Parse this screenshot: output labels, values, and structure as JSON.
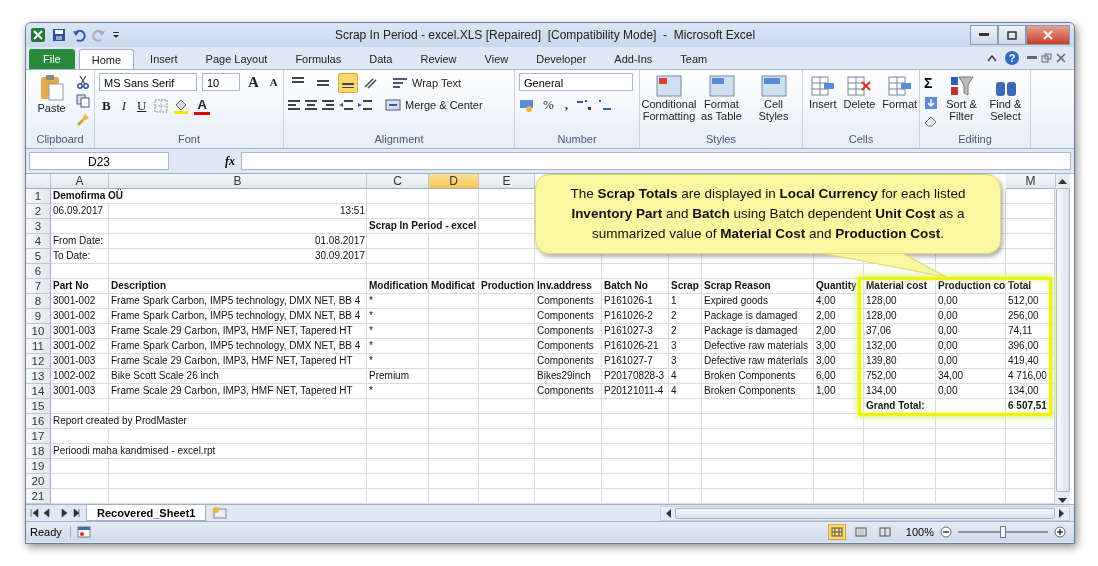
{
  "window": {
    "title": "Scrap In Period - excel.XLS [Repaired]  [Compatibility Mode]  -  Microsoft Excel"
  },
  "ribbon_tabs": [
    {
      "label": "File",
      "kind": "file",
      "selected": false
    },
    {
      "label": "Home",
      "kind": "tab",
      "selected": true
    },
    {
      "label": "Insert",
      "kind": "tab",
      "selected": false
    },
    {
      "label": "Page Layout",
      "kind": "tab",
      "selected": false
    },
    {
      "label": "Formulas",
      "kind": "tab",
      "selected": false
    },
    {
      "label": "Data",
      "kind": "tab",
      "selected": false
    },
    {
      "label": "Review",
      "kind": "tab",
      "selected": false
    },
    {
      "label": "View",
      "kind": "tab",
      "selected": false
    },
    {
      "label": "Developer",
      "kind": "tab",
      "selected": false
    },
    {
      "label": "Add-Ins",
      "kind": "tab",
      "selected": false
    },
    {
      "label": "Team",
      "kind": "tab",
      "selected": false
    }
  ],
  "help": "?",
  "clipboard": {
    "label": "Clipboard",
    "paste": "Paste"
  },
  "font": {
    "label": "Font",
    "name": "MS Sans Serif",
    "size": "10",
    "grow": "A",
    "shrink": "A",
    "bold": "B",
    "italic": "I",
    "underline": "U",
    "color_letter": "A"
  },
  "alignment": {
    "label": "Alignment",
    "vertical": [
      {
        "selected": false
      },
      {
        "selected": false
      },
      {
        "selected": true
      }
    ],
    "wrap": "Wrap Text",
    "merge": "Merge & Center"
  },
  "number": {
    "label": "Number",
    "format": "General",
    "percent": "%",
    "comma": ","
  },
  "styles": {
    "label": "Styles",
    "buttons": [
      "Conditional Formatting",
      "Format as Table",
      "Cell Styles"
    ]
  },
  "cells": {
    "label": "Cells",
    "buttons": [
      "Insert",
      "Delete",
      "Format"
    ]
  },
  "editing": {
    "label": "Editing",
    "sum": "Σ",
    "buttons": [
      "Sort & Filter",
      "Find & Select"
    ]
  },
  "formula_bar": {
    "name_box": "D23",
    "fx": "fx"
  },
  "sheet": {
    "columns": [
      {
        "letter": "A",
        "selected": false
      },
      {
        "letter": "B",
        "selected": false
      },
      {
        "letter": "C",
        "selected": false
      },
      {
        "letter": "D",
        "selected": true
      },
      {
        "letter": "E",
        "selected": false
      },
      {
        "letter": "M",
        "selected": false
      }
    ],
    "rows": [
      {
        "number": "1",
        "kind": "heading",
        "A": "Demofirma OÜ"
      },
      {
        "number": "2",
        "kind": "date",
        "A": "06.09.2017",
        "B": "13:51"
      },
      {
        "number": "3",
        "kind": "heading",
        "C": "Scrap In Period - excel"
      },
      {
        "number": "4",
        "kind": "date",
        "A": "From Date:",
        "B": "01.08.2017"
      },
      {
        "number": "5",
        "kind": "date",
        "A": "To Date:",
        "B": "30.09.2017"
      },
      {
        "number": "6",
        "kind": "text"
      },
      {
        "number": "7",
        "kind": "heading",
        "A": "Part No",
        "B": "Description",
        "C": "Modification",
        "D": "Modificat",
        "E": "Production",
        "F": "Inv.address",
        "G": "Batch No",
        "H": "Scrap",
        "I": "Scrap Reason",
        "J": "Quantity",
        "K": "Material cost",
        "L": "Production co",
        "M": "Total"
      },
      {
        "number": "8",
        "kind": "text",
        "A": "3001-002",
        "B": "Frame Spark Carbon, IMP5 technology, DMX NET, BB 4",
        "C": "*",
        "F": "Components",
        "G": "P161026-1",
        "H": "1",
        "I": "Expired goods",
        "J": "4,00",
        "K": "128,00",
        "L": "0,00",
        "M": "512,00"
      },
      {
        "number": "9",
        "kind": "text",
        "A": "3001-002",
        "B": "Frame Spark Carbon, IMP5 technology, DMX NET, BB 4",
        "C": "*",
        "F": "Components",
        "G": "P161026-2",
        "H": "2",
        "I": "Package is damaged",
        "J": "2,00",
        "K": "128,00",
        "L": "0,00",
        "M": "256,00"
      },
      {
        "number": "10",
        "kind": "text",
        "A": "3001-003",
        "B": "Frame Scale 29 Carbon, IMP3, HMF NET, Tapered HT",
        "C": "*",
        "F": "Components",
        "G": "P161027-3",
        "H": "2",
        "I": "Package is damaged",
        "J": "2,00",
        "K": "37,06",
        "L": "0,00",
        "M": "74,11"
      },
      {
        "number": "11",
        "kind": "text",
        "A": "3001-002",
        "B": "Frame Spark Carbon, IMP5 technology, DMX NET, BB 4",
        "C": "*",
        "F": "Components",
        "G": "P161026-21",
        "H": "3",
        "I": "Defective raw materials",
        "J": "3,00",
        "K": "132,00",
        "L": "0,00",
        "M": "396,00"
      },
      {
        "number": "12",
        "kind": "text",
        "A": "3001-003",
        "B": "Frame Scale 29 Carbon, IMP3, HMF NET, Tapered HT",
        "C": "*",
        "F": "Components",
        "G": "P161027-7",
        "H": "3",
        "I": "Defective raw materials",
        "J": "3,00",
        "K": "139,80",
        "L": "0,00",
        "M": "419,40"
      },
      {
        "number": "13",
        "kind": "text",
        "A": "1002-002",
        "B": "Bike Scott Scale 26 inch",
        "C": "Premium",
        "F": "Bikes29inch",
        "G": "P20170828-3",
        "H": "4",
        "I": "Broken Components",
        "J": "6,00",
        "K": "752,00",
        "L": "34,00",
        "M": "4 716,00"
      },
      {
        "number": "14",
        "kind": "text",
        "A": "3001-003",
        "B": "Frame Scale 29 Carbon, IMP3, HMF NET, Tapered HT",
        "C": "*",
        "F": "Components",
        "G": "P20121011-4",
        "H": "4",
        "I": "Broken Components",
        "J": "1,00",
        "K": "134,00",
        "L": "0,00",
        "M": "134,00"
      },
      {
        "number": "15",
        "kind": "heading",
        "K": "Grand Total:",
        "M": "6 507,51"
      },
      {
        "number": "16",
        "kind": "text",
        "A": "Report created by ProdMaster"
      },
      {
        "number": "17",
        "kind": "text"
      },
      {
        "number": "18",
        "kind": "text",
        "A": "Perioodi maha kandmised - excel.rpt"
      },
      {
        "number": "19",
        "kind": "text"
      },
      {
        "number": "20",
        "kind": "text"
      },
      {
        "number": "21",
        "kind": "text"
      }
    ]
  },
  "callout": {
    "text": "The **Scrap Totals** are displayed in **Local Currency** for each listed **Inventory Part** and **Batch** using Batch dependent **Unit Cost** as a summarized value of **Material Cost** and **Production Cost**."
  },
  "sheet_tabs": [
    {
      "label": "Recovered_Sheet1",
      "selected": true
    }
  ],
  "status_bar": {
    "status": "Ready",
    "views": [
      {
        "selected": true
      },
      {
        "selected": false
      },
      {
        "selected": false
      }
    ],
    "zoom": {
      "label": "100%",
      "level": 0.5
    }
  }
}
